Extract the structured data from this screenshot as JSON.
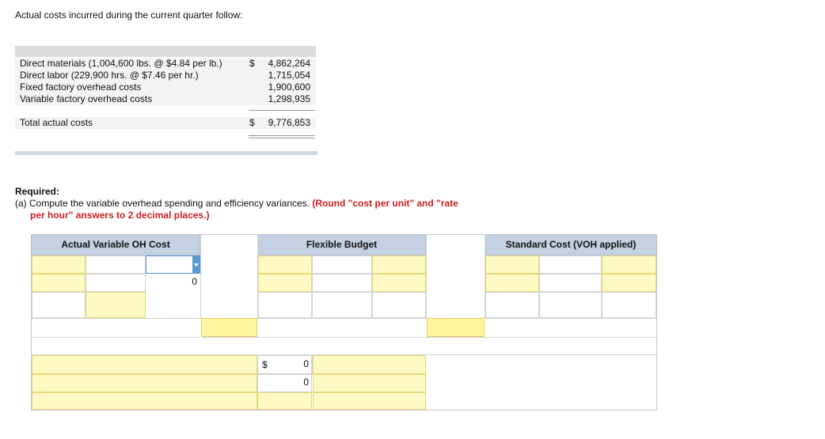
{
  "intro": "Actual costs incurred during the current quarter follow:",
  "costs": {
    "rows": [
      {
        "label": "Direct materials (1,004,600 lbs. @ $4.84 per lb.)",
        "dollar": "$",
        "value": "4,862,264"
      },
      {
        "label": "Direct labor (229,900 hrs. @ $7.46 per hr.)",
        "dollar": "",
        "value": "1,715,054"
      },
      {
        "label": "Fixed factory overhead costs",
        "dollar": "",
        "value": "1,900,600"
      },
      {
        "label": "Variable factory overhead costs",
        "dollar": "",
        "value": "1,298,935"
      }
    ],
    "total_label": "Total actual costs",
    "total_dollar": "$",
    "total_value": "9,776,853"
  },
  "required": {
    "title": "Required:",
    "part_a": "(a) Compute the variable overhead spending and efficiency variances.",
    "note_line1": "(Round \"cost per unit\" and \"rate",
    "note_line2": "per hour\" answers to 2 decimal places.)"
  },
  "worksheet": {
    "headers": {
      "actual": "Actual Variable OH Cost",
      "flexible": "Flexible Budget",
      "standard": "Standard Cost (VOH applied)"
    },
    "actual_total": "0",
    "dollar_sign": "$",
    "variance_total_1": "0",
    "variance_total_2": "0"
  }
}
